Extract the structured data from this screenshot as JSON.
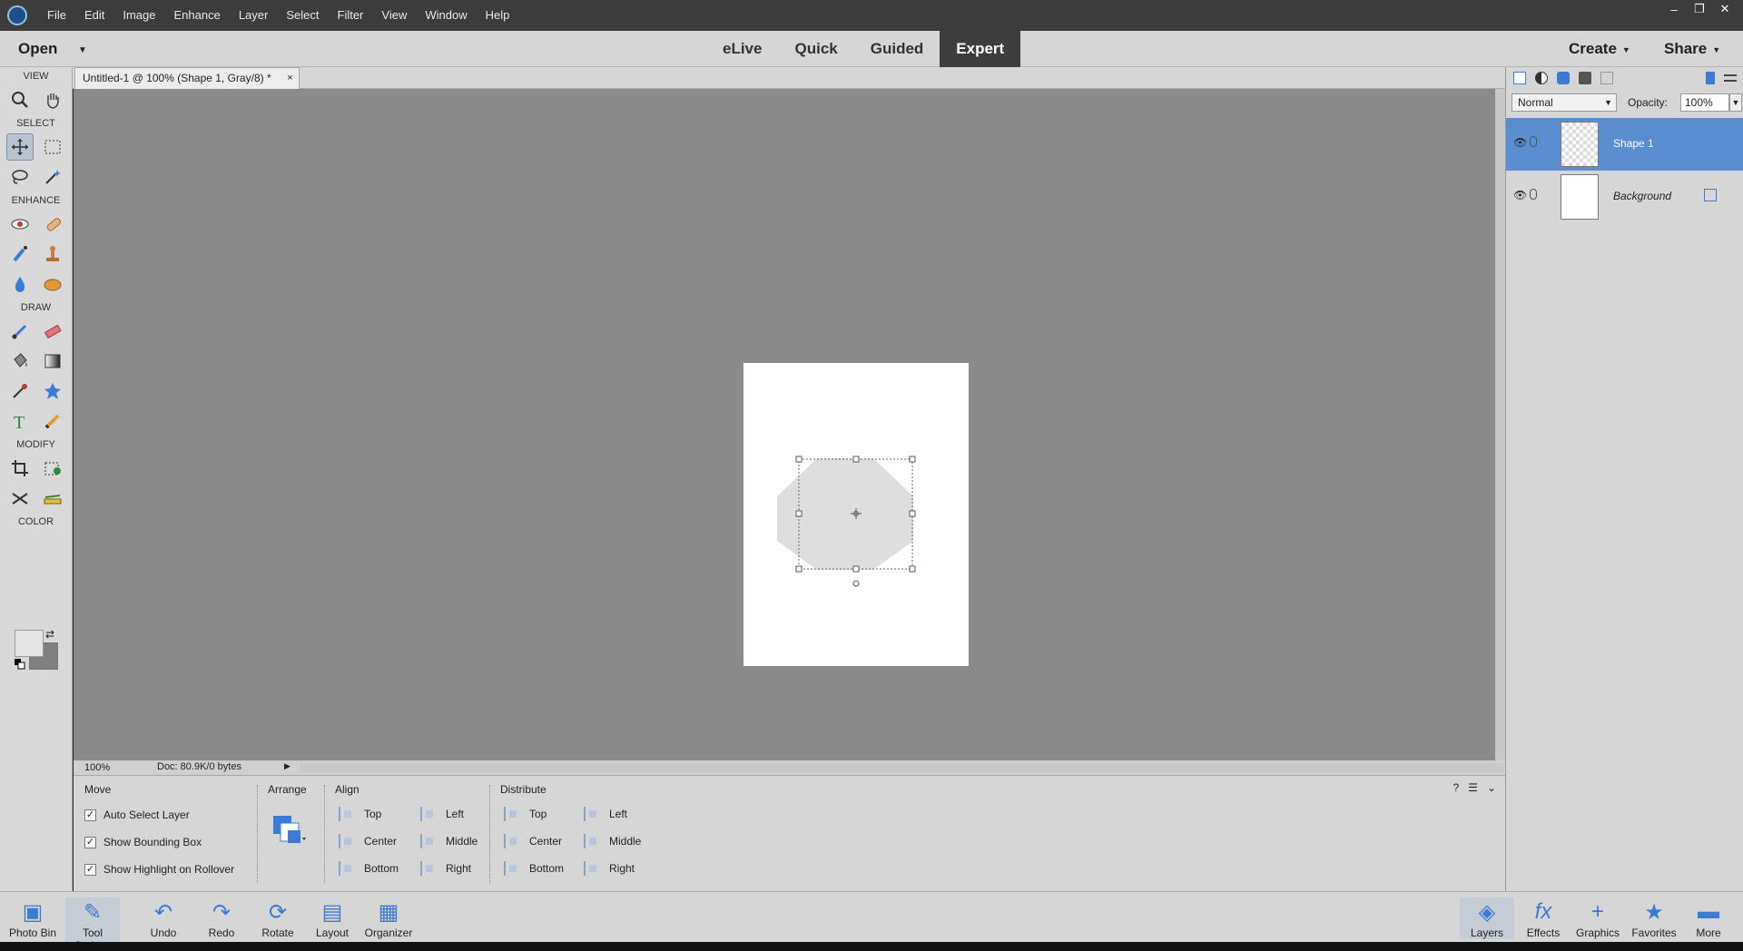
{
  "menu": {
    "items": [
      "File",
      "Edit",
      "Image",
      "Enhance",
      "Layer",
      "Select",
      "Filter",
      "View",
      "Window",
      "Help"
    ]
  },
  "window": {
    "minimize": "–",
    "restore": "❐",
    "close": "✕"
  },
  "modebar": {
    "open_label": "Open",
    "modes": [
      "eLive",
      "Quick",
      "Guided",
      "Expert"
    ],
    "active_mode": "Expert",
    "create_label": "Create",
    "share_label": "Share"
  },
  "toolbox": {
    "sections": [
      "VIEW",
      "SELECT",
      "ENHANCE",
      "DRAW",
      "MODIFY",
      "COLOR"
    ]
  },
  "document": {
    "tab_title": "Untitled-1 @ 100% (Shape 1, Gray/8) *",
    "tab_close": "×",
    "zoom": "100%",
    "doc_info": "Doc: 80.9K/0 bytes",
    "shape_color": "#dedede"
  },
  "layers": {
    "blend_mode": "Normal",
    "opacity_label": "Opacity:",
    "opacity_value": "100%",
    "list": [
      {
        "name": "Shape 1",
        "active": true
      },
      {
        "name": "Background",
        "active": false
      }
    ]
  },
  "tool_options": {
    "tool_name": "Move",
    "checkboxes": [
      {
        "label": "Auto Select Layer",
        "checked": true
      },
      {
        "label": "Show Bounding Box",
        "checked": true
      },
      {
        "label": "Show Highlight on Rollover",
        "checked": true
      }
    ],
    "arrange_label": "Arrange",
    "align_label": "Align",
    "align": {
      "top": "Top",
      "center": "Center",
      "bottom": "Bottom",
      "left": "Left",
      "middle": "Middle",
      "right": "Right"
    },
    "distribute_label": "Distribute",
    "distribute": {
      "top": "Top",
      "center": "Center",
      "bottom": "Bottom",
      "left": "Left",
      "middle": "Middle",
      "right": "Right"
    }
  },
  "taskbar": {
    "photo_bin": "Photo Bin",
    "tool_options": "Tool Options",
    "undo": "Undo",
    "redo": "Redo",
    "rotate": "Rotate",
    "layout": "Layout",
    "organizer": "Organizer",
    "layers": "Layers",
    "effects": "Effects",
    "graphics": "Graphics",
    "favorites": "Favorites",
    "more": "More"
  }
}
